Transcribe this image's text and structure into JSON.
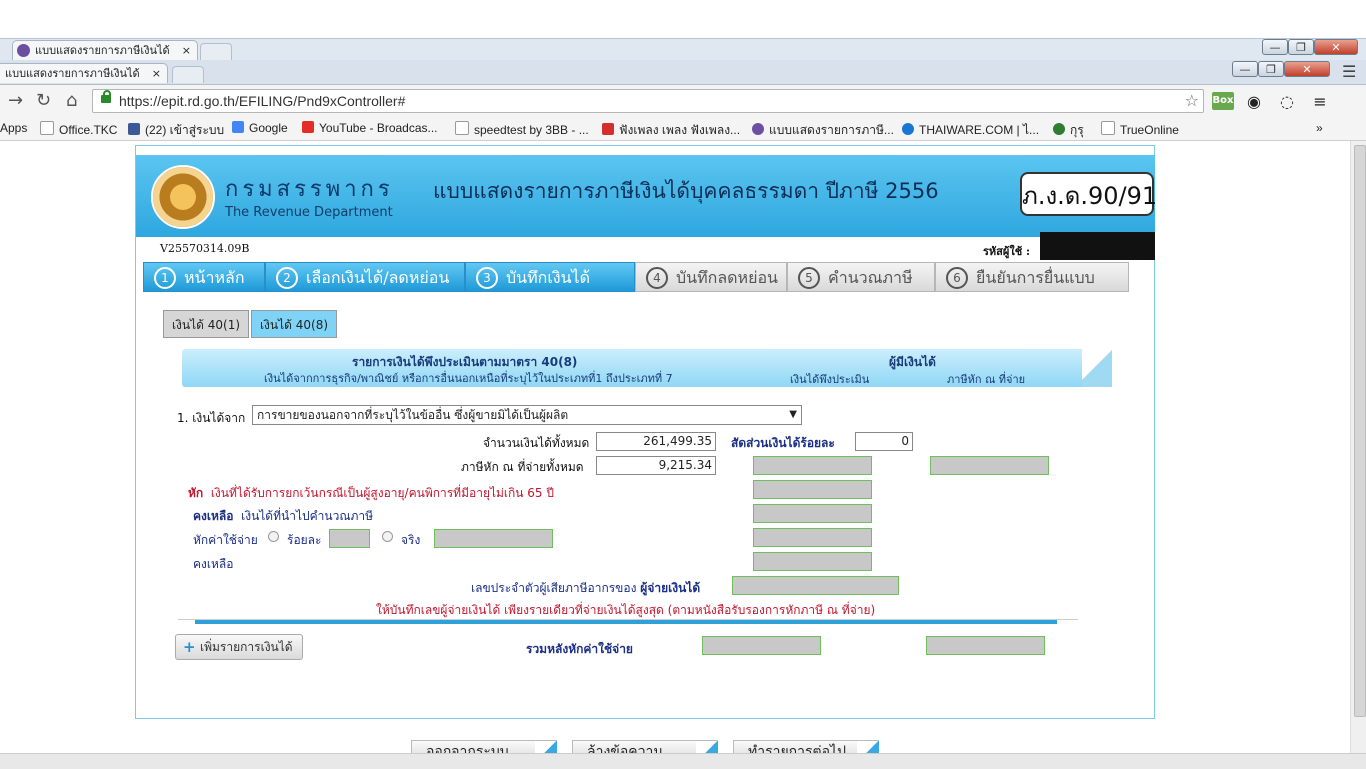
{
  "browser": {
    "tab_title": "แบบแสดงรายการภาษีเงินได้",
    "tab_close": "×",
    "url": "https://epit.rd.go.th/EFILING/Pnd9xController#",
    "window_buttons": {
      "minimize": "—",
      "restore": "❐",
      "close": "✕"
    },
    "ext_box_label": "Box",
    "bookmarks": [
      {
        "label": "Apps",
        "color": "#3b73d9"
      },
      {
        "label": "Office.TKC",
        "color": "#bbbbbb"
      },
      {
        "label": "(22) เข้าสู่ระบบ",
        "color": "#3b5998"
      },
      {
        "label": "Google",
        "color": "#4285f4"
      },
      {
        "label": "YouTube - Broadcas...",
        "color": "#e52d27"
      },
      {
        "label": "speedtest by 3BB - ...",
        "color": "#bbbbbb"
      },
      {
        "label": "ฟังเพลง เพลง ฟังเพลง...",
        "color": "#d32f2f"
      },
      {
        "label": "แบบแสดงรายการภาษี...",
        "color": "#6b4fa0"
      },
      {
        "label": "THAIWARE.COM | ไ...",
        "color": "#1976d2"
      },
      {
        "label": "กุรุ",
        "color": "#2e7d32"
      },
      {
        "label": "TrueOnline",
        "color": "#bbbbbb"
      }
    ],
    "bookmarks_more": "»"
  },
  "header": {
    "dept_th": "กรมสรรพากร",
    "dept_en": "The Revenue Department",
    "title": "แบบแสดงรายการภาษีเงินได้บุคคลธรรมดา ปีภาษี 2556",
    "form_code": "ภ.ง.ด.90/91"
  },
  "meta": {
    "version": "V25570314.09B",
    "user_label": "รหัสผู้ใช้ :"
  },
  "steps": [
    {
      "num": "1",
      "label": "หน้าหลัก"
    },
    {
      "num": "2",
      "label": "เลือกเงินได้/ลดหย่อน"
    },
    {
      "num": "3",
      "label": "บันทึกเงินได้"
    },
    {
      "num": "4",
      "label": "บันทึกลดหย่อน"
    },
    {
      "num": "5",
      "label": "คำนวณภาษี"
    },
    {
      "num": "6",
      "label": "ยืนยันการยื่นแบบ"
    }
  ],
  "income_tabs": [
    "เงินได้ 40(1)",
    "เงินได้ 40(8)"
  ],
  "banner": {
    "title": "รายการเงินได้พึงประเมินตามมาตรา 40(8)",
    "subtitle": "เงินได้จากการธุรกิจ/พาณิชย์ หรือการอื่นนอกเหนือที่ระบุไว้ในประเภทที่1 ถึงประเภทที่ 7",
    "payer_header": "ผู้มีเงินได้",
    "col_assessable": "เงินได้พึงประเมิน",
    "col_withholding": "ภาษีหัก ณ ที่จ่าย"
  },
  "form": {
    "income_from_label": "1. เงินได้จาก",
    "income_source_selected": "การขายของนอกจากที่ระบุไว้ในข้ออื่น ซึ่งผู้ขายมิได้เป็นผู้ผลิต",
    "total_income_label": "จำนวนเงินได้ทั้งหมด",
    "total_income_value": "261,499.35",
    "share_percent_label": "สัดส่วนเงินได้ร้อยละ",
    "share_percent_value": "0",
    "withholding_total_label": "ภาษีหัก ณ ที่จ่ายทั้งหมด",
    "withholding_total_value": "9,215.34",
    "deduct_prefix": "หัก",
    "exempt_label": "เงินที่ได้รับการยกเว้นกรณีเป็นผู้สูงอายุ/คนพิการที่มีอายุไม่เกิน 65 ปี",
    "remaining_prefix": "คงเหลือ",
    "remaining_label": "เงินได้ที่นำไปคำนวณภาษี",
    "expense_label": "หักค่าใช้จ่าย",
    "percent_option": "ร้อยละ",
    "actual_option": "จริง",
    "remaining2_label": "คงเหลือ",
    "payer_tax_id_label": "เลขประจำตัวผู้เสียภาษีอากรของ",
    "payer_tax_id_strong": "ผู้จ่ายเงินได้",
    "note": "ให้บันทึกเลขผู้จ่ายเงินได้ เพียงรายเดียวที่จ่ายเงินได้สูงสุด (ตามหนังสือรับรองการหักภาษี ณ ที่จ่าย)",
    "add_income_button": "เพิ่มรายการเงินได้",
    "add_icon": "+",
    "total_after_expense_label": "รวมหลังหักค่าใช้จ่าย"
  },
  "bottom_buttons": [
    "ออกจากระบบ",
    "ล้างข้อความ",
    "ทำรายการต่อไป"
  ],
  "colors": {
    "accent": "#2ea7df",
    "active_tab": "#7ed3f7",
    "red_text": "#c0162e",
    "navy_text": "#1b2f86"
  }
}
